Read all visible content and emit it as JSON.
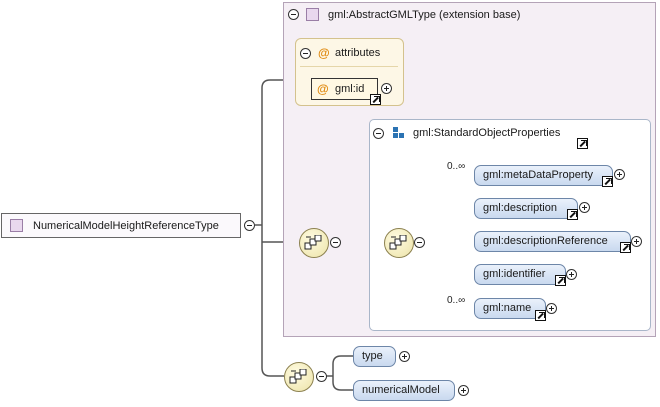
{
  "root": {
    "label": "NumericalModelHeightReferenceType"
  },
  "base_type": {
    "label": "gml:AbstractGMLType (extension base)"
  },
  "attributes": {
    "label": "attributes",
    "items": [
      {
        "label": "gml:id"
      }
    ]
  },
  "group": {
    "label": "gml:StandardObjectProperties",
    "elements": [
      {
        "label": "gml:metaDataProperty",
        "cardinality": "0..∞"
      },
      {
        "label": "gml:description",
        "cardinality": ""
      },
      {
        "label": "gml:descriptionReference",
        "cardinality": ""
      },
      {
        "label": "gml:identifier",
        "cardinality": ""
      },
      {
        "label": "gml:name",
        "cardinality": "0..∞"
      }
    ]
  },
  "local_elements": [
    {
      "label": "type"
    },
    {
      "label": "numericalModel"
    }
  ],
  "colors": {
    "extension_bg": "#f5eff5",
    "extension_border": "#b4a3b7",
    "attributes_bg": "#fdf7e6",
    "attributes_border": "#d4c28d",
    "group_border": "#a9b6c9",
    "element_fill": "#c9d9ef",
    "compositor_fill": "#ece3a8",
    "line": "#555555"
  },
  "icons": {
    "complex_type": "complex-type-icon",
    "attribute": "attribute-icon",
    "model_group": "model-group-icon",
    "sequence": "sequence-compositor-icon",
    "reference": "reference-link-icon",
    "collapse": "collapse-icon",
    "expand": "expand-icon"
  }
}
